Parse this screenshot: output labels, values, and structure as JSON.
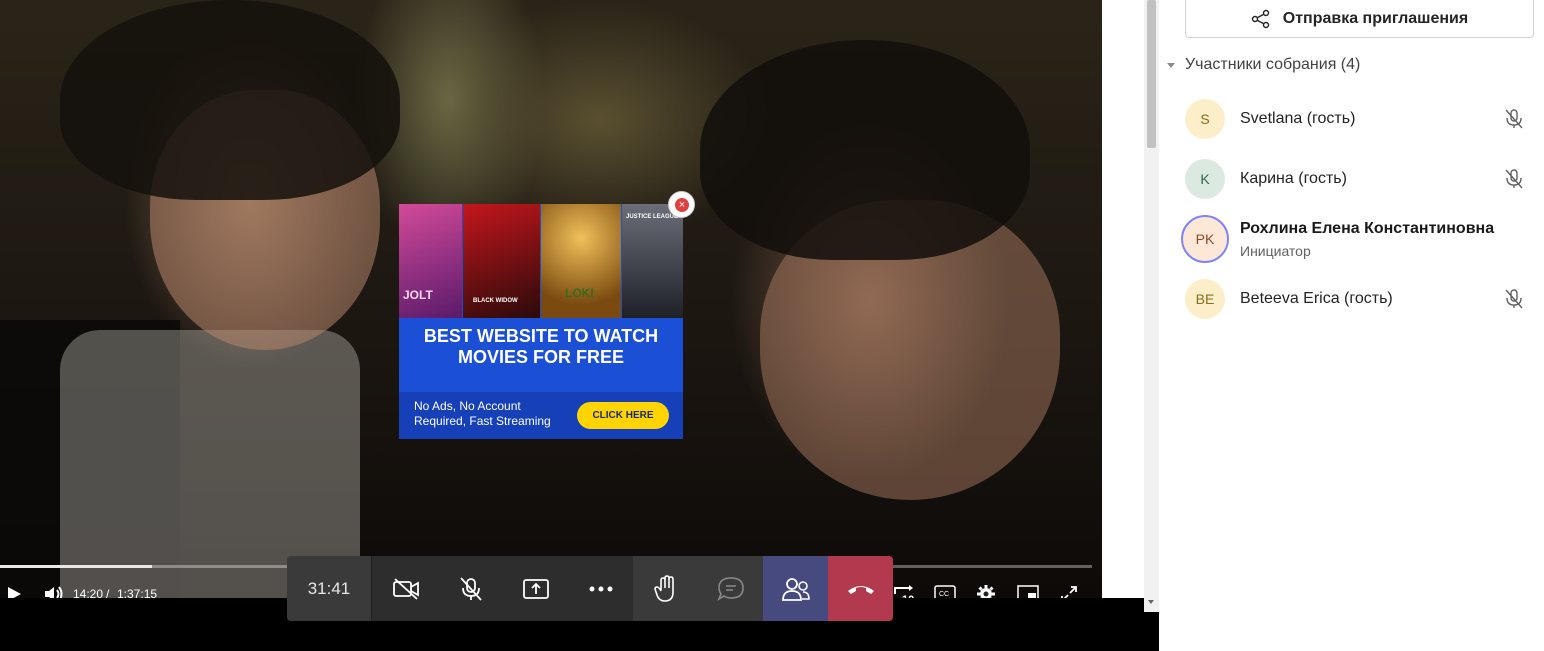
{
  "video": {
    "current_time": "14:20",
    "separator": "/",
    "duration": "1:37:15",
    "progress": 0.139
  },
  "ad": {
    "posters": [
      "JOLT",
      "BLACK WIDOW",
      "LOKI",
      "JUSTICE LEAGUE"
    ],
    "headline_line1": "BEST WEBSITE TO WATCH",
    "headline_line2": "MOVIES FOR FREE",
    "subtext": "No Ads, No Account Required, Fast Streaming",
    "cta_label": "CLICK HERE",
    "colors": {
      "background": "#1a4fd6",
      "cta": "#ffd400"
    }
  },
  "toolbar": {
    "timer": "31:41",
    "icons": [
      "camera-off-icon",
      "mic-off-icon",
      "share-screen-icon",
      "more-icon",
      "raise-hand-icon",
      "chat-icon",
      "people-icon",
      "hang-up-icon"
    ],
    "colors": {
      "people_active": "#464a7e",
      "hang_up": "#b33a4e"
    }
  },
  "panel": {
    "invite_label": "Отправка приглашения",
    "section_title": "Участники собрания (4)",
    "participants": [
      {
        "initials": "S",
        "name": "Svetlana (гость)",
        "muted": true,
        "avatar_bg": "#fbeec8",
        "avatar_fg": "#8a6d1a"
      },
      {
        "initials": "K",
        "name": "Карина (гость)",
        "muted": true,
        "avatar_bg": "#dbe9e1",
        "avatar_fg": "#2e6b4a"
      },
      {
        "initials": "PK",
        "name": "Рохлина Елена Константиновна",
        "role": "Инициатор",
        "muted": false,
        "avatar_bg": "#fde8d8",
        "avatar_fg": "#8a4a2a"
      },
      {
        "initials": "BE",
        "name": "Beteeva Erica (гость)",
        "muted": true,
        "avatar_bg": "#fbeec8",
        "avatar_fg": "#8a6d1a"
      }
    ]
  }
}
